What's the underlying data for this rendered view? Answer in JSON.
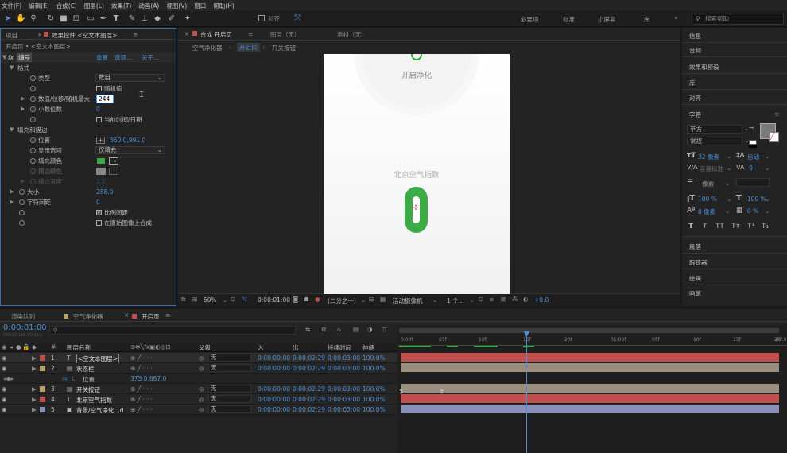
{
  "menu": [
    "文件(F)",
    "编辑(E)",
    "合成(C)",
    "图层(L)",
    "效果(T)",
    "动画(A)",
    "视图(V)",
    "窗口",
    "帮助(H)"
  ],
  "toolbar": {
    "align_label": "对齐",
    "workspaces": [
      "必要项",
      "标准",
      "小屏幕",
      "库"
    ],
    "search_placeholder": "搜索帮助"
  },
  "left_panel": {
    "tab_project": "项目",
    "tab_effects": "效果控件 <空文本图层>",
    "breadcrumb": "开启页 • <空文本图层>",
    "fx_name": "编号",
    "reset": "重置",
    "options": "选项...",
    "about": "关于...",
    "rows": {
      "format": "格式",
      "type_label": "类型",
      "type_value": "数目",
      "random_label": "随机值",
      "number_label": "数值/位移/随机最大",
      "number_value": "244",
      "decimals_label": "小数位数",
      "decimals_value": "0",
      "current_time_label": "当前时间/日期",
      "fill_stroke": "填充和描边",
      "position_label": "位置",
      "position_value": "360.0,991.0",
      "display_label": "显示选项",
      "display_value": "仅填充",
      "fill_color_label": "填充颜色",
      "stroke_color_label": "描边颜色",
      "stroke_width_label": "描边宽度",
      "stroke_width_value": "2.0",
      "size_label": "大小",
      "size_value": "288.0",
      "tracking_label": "字符间距",
      "tracking_value": "0",
      "proportional_label": "比例间距",
      "composite_label": "在原始图像上合成"
    }
  },
  "viewer": {
    "tab_comp": "合成 开启页",
    "tab_layer": "图层（无）",
    "tab_footage": "素材（无）",
    "breadcrumbs": [
      "空气净化器",
      "开启页",
      "开关按钮"
    ],
    "canvas_text_top": "开启净化",
    "canvas_text_mid": "北京空气指数",
    "zoom": "50%",
    "timecode": "0:00:01:00",
    "resolution": "(二分之一)",
    "camera": "活动摄像机",
    "views": "1 个...",
    "exposure": "+0.0",
    "brand_green": "#3daa47"
  },
  "right_panel": {
    "items_top": [
      "信息",
      "音频",
      "效果和预设",
      "库",
      "对齐"
    ],
    "character_title": "字符",
    "font_family": "苹方",
    "font_style": "常规",
    "font_size": "32 像素",
    "leading": "自动",
    "kerning": "度量标准",
    "tracking": "0",
    "stroke_unit": "- 像素",
    "vscale": "100 %",
    "hscale": "100 %",
    "baseline": "0 像素",
    "tsume": "0 %",
    "type_buttons": [
      "T",
      "T",
      "TT",
      "Tт",
      "T¹",
      "T₁"
    ],
    "items_bottom": [
      "段落",
      "跟踪器",
      "绘画",
      "画笔"
    ]
  },
  "timeline": {
    "tabs": [
      "渲染队列",
      "空气净化器",
      "开启页"
    ],
    "timecode": "0:00:01:00",
    "timecode_sub": "00025 (25.00 fps)",
    "columns": [
      "图层名称",
      "父级",
      "入",
      "出",
      "持续时间",
      "伸缩"
    ],
    "ruler": [
      "0:00f",
      "05f",
      "10f",
      "15f",
      "20f",
      "01:00f",
      "05f",
      "10f",
      "15f",
      "20f",
      "02:0"
    ],
    "layers": [
      {
        "num": "1",
        "type": "T",
        "name": "<空文本图层>",
        "parent": "无",
        "in": "0:00:00:00",
        "out": "0:00:02:29",
        "dur": "0:00:03:00",
        "stretch": "100.0%",
        "label": "#c0504d",
        "bar": "#c0504d"
      },
      {
        "num": "2",
        "type": "comp",
        "name": "状态栏",
        "parent": "无",
        "in": "0:00:00:00",
        "out": "0:00:02:29",
        "dur": "0:00:03:00",
        "stretch": "100.0%",
        "label": "#b8a26a",
        "bar": "#9b8e7e"
      },
      {
        "num": "3",
        "type": "comp",
        "name": "开关按钮",
        "parent": "无",
        "in": "0:00:00:00",
        "out": "0:00:02:29",
        "dur": "0:00:03:00",
        "stretch": "100.0%",
        "label": "#b8a26a",
        "bar": "#9b8e7e"
      },
      {
        "num": "4",
        "type": "T",
        "name": "北京空气指数",
        "parent": "无",
        "in": "0:00:00:00",
        "out": "0:00:02:29",
        "dur": "0:00:03:00",
        "stretch": "100.0%",
        "label": "#c0504d",
        "bar": "#c0504d"
      },
      {
        "num": "5",
        "type": "img",
        "name": "背景/空气净化...d",
        "parent": "无",
        "in": "0:00:00:00",
        "out": "0:00:02:29",
        "dur": "0:00:03:00",
        "stretch": "100.0%",
        "label": "#8a8fb5",
        "bar": "#8a8fb5"
      }
    ],
    "sub_prop_name": "位置",
    "sub_prop_value": "375.0,667.0"
  }
}
